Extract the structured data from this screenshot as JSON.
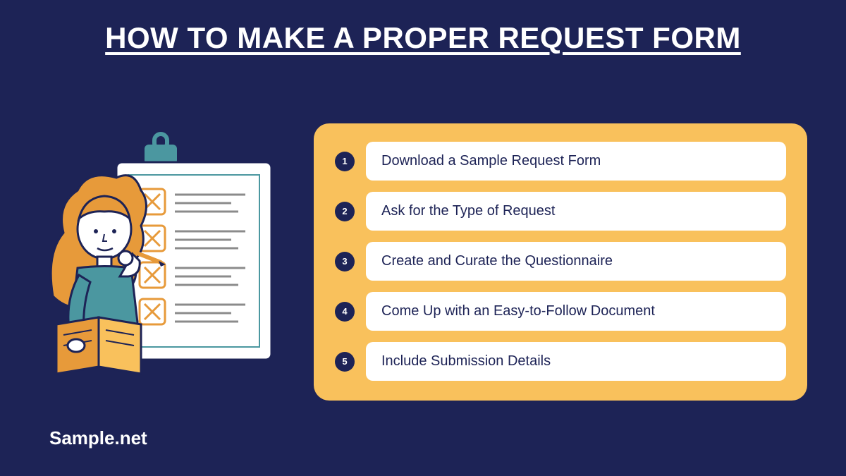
{
  "title": "HOW TO MAKE A PROPER REQUEST FORM",
  "steps": [
    {
      "num": "1",
      "label": "Download a Sample Request Form"
    },
    {
      "num": "2",
      "label": "Ask for the Type of Request"
    },
    {
      "num": "3",
      "label": "Create and Curate the Questionnaire"
    },
    {
      "num": "4",
      "label": "Come Up with an Easy-to-Follow Document"
    },
    {
      "num": "5",
      "label": "Include Submission Details"
    }
  ],
  "watermark": "Sample.net",
  "colors": {
    "background": "#1d2356",
    "panel": "#f9c15c",
    "white": "#ffffff",
    "teal": "#4b97a0",
    "orange": "#e79a3a"
  }
}
